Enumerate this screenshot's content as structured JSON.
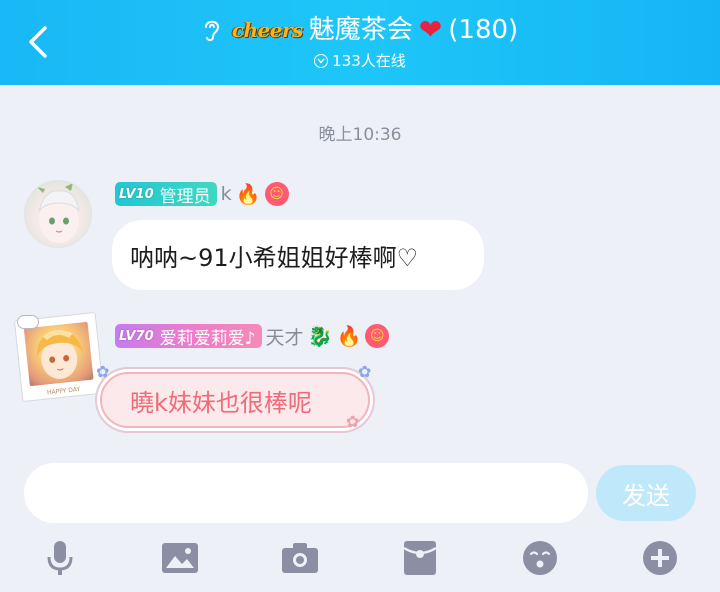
{
  "header": {
    "brand_logo_text": "cheers",
    "title": "魅魔茶会",
    "member_count": "(180)",
    "online_text": "133人在线"
  },
  "chat": {
    "timestamp": "晚上10:36",
    "messages": [
      {
        "level": "LV10",
        "role": "管理员",
        "nickname": "k",
        "text": "呐呐~91小希姐姐好棒啊♡"
      },
      {
        "level": "LV70",
        "title_badge": "爱莉爱莉爱♪",
        "nickname": "天才",
        "frame_caption": "HAPPY DAY",
        "text": "曉k妹妹也很棒呢"
      }
    ]
  },
  "composer": {
    "input_value": "",
    "send_label": "发送"
  },
  "colors": {
    "header_blue": "#19b8f6",
    "send_disabled": "#bfe9fb",
    "pink_bubble_text": "#ee6c7a"
  },
  "icons": [
    "back-arrow-icon",
    "ear-icon",
    "heart-icon",
    "online-indicator-icon",
    "fire-icon",
    "flower-icon",
    "dragon-icon",
    "microphone-icon",
    "image-icon",
    "camera-icon",
    "red-packet-icon",
    "emoji-icon",
    "plus-icon"
  ]
}
